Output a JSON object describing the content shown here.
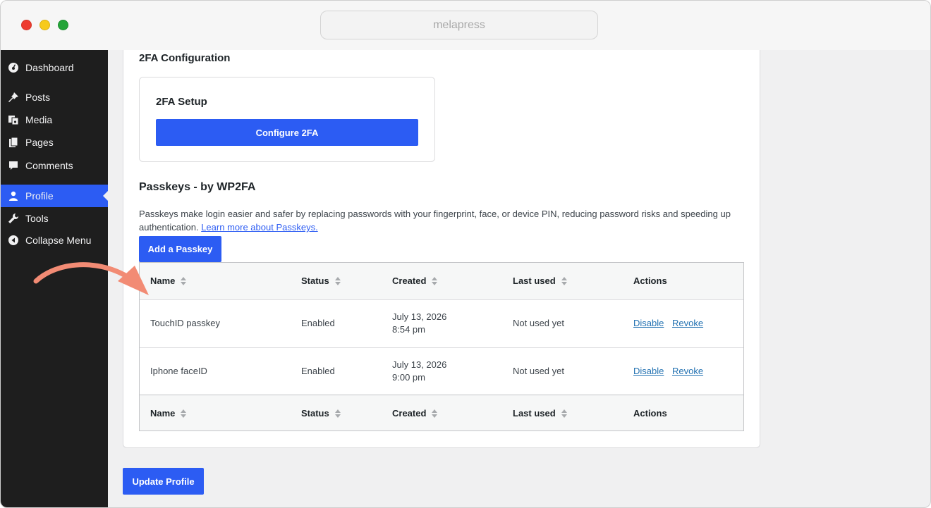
{
  "browser": {
    "address": "melapress"
  },
  "sidebar": {
    "items": [
      {
        "label": "Dashboard",
        "icon": "dashboard-icon"
      },
      {
        "label": "Posts",
        "icon": "pin-icon"
      },
      {
        "label": "Media",
        "icon": "media-icon"
      },
      {
        "label": "Pages",
        "icon": "pages-icon"
      },
      {
        "label": "Comments",
        "icon": "comment-icon"
      },
      {
        "label": "Profile",
        "icon": "user-icon",
        "active": true
      },
      {
        "label": "Tools",
        "icon": "wrench-icon"
      },
      {
        "label": "Collapse Menu",
        "icon": "collapse-icon"
      }
    ]
  },
  "twofa": {
    "heading": "2FA Configuration",
    "setup_title": "2FA Setup",
    "configure_button": "Configure 2FA"
  },
  "passkeys": {
    "heading": "Passkeys - by WP2FA",
    "description": "Passkeys make login easier and safer by replacing passwords with your fingerprint, face, or device PIN, reducing password risks and speeding up authentication.",
    "learn_more": "Learn more about Passkeys.",
    "add_button": "Add a Passkey",
    "columns": [
      "Name",
      "Status",
      "Created",
      "Last used",
      "Actions"
    ],
    "rows": [
      {
        "name": "TouchID passkey",
        "status": "Enabled",
        "created_date": "July 13, 2026",
        "created_time": "8:54 pm",
        "last_used": "Not used yet",
        "disable": "Disable",
        "revoke": "Revoke"
      },
      {
        "name": "Iphone faceID",
        "status": "Enabled",
        "created_date": "July 13, 2026",
        "created_time": "9:00 pm",
        "last_used": "Not used yet",
        "disable": "Disable",
        "revoke": "Revoke"
      }
    ]
  },
  "footer": {
    "update_button": "Update Profile"
  },
  "colors": {
    "accent": "#2c5cf3",
    "sidebar": "#1e1e1e",
    "arrow": "#f28b74",
    "link": "#2271b1"
  }
}
